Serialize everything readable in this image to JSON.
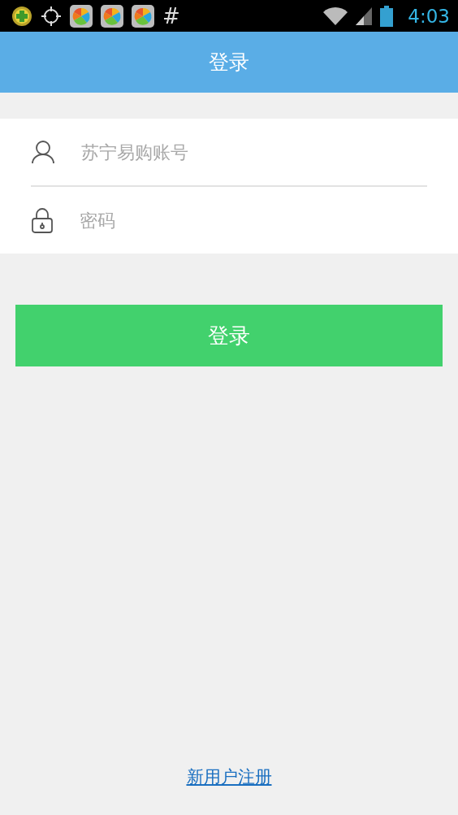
{
  "status_bar": {
    "notification_text": "#",
    "time": "4:03"
  },
  "header": {
    "title": "登录"
  },
  "form": {
    "account": {
      "placeholder": "苏宁易购账号"
    },
    "password": {
      "placeholder": "密码"
    }
  },
  "login_button": "登录",
  "register_link": "新用户注册"
}
